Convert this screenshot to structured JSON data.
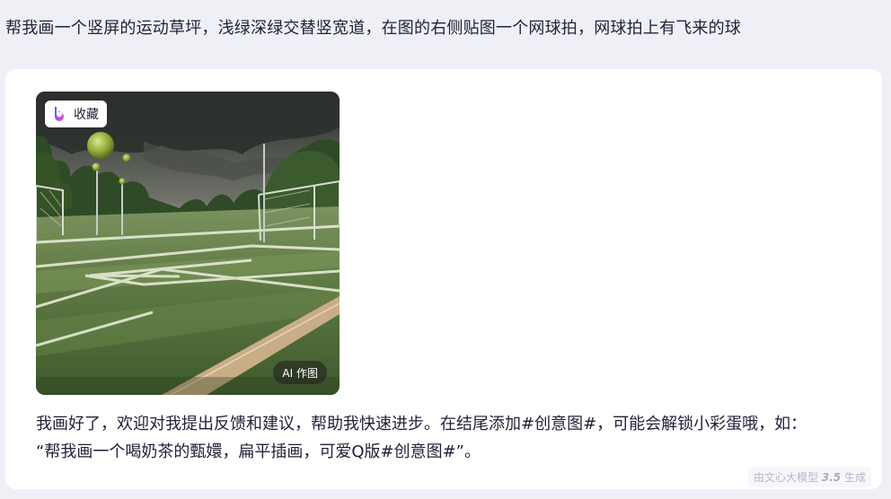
{
  "user_message": {
    "text": "帮我画一个竖屏的运动草坪，浅绿深绿交替竖宽道，在图的右侧贴图一个网球拍，网球拍上有飞来的球"
  },
  "answer": {
    "image": {
      "collect_label": "收藏",
      "logo_icon": "wenxin-logo-icon",
      "ai_badge_label": "AI 作图"
    },
    "text_line1": "我画好了，欢迎对我提出反馈和建议，帮助我快速进步。在结尾添加#创意图#，可能会解锁小彩蛋哦，如：",
    "text_line2": "“帮我画一个喝奶茶的甄嬛，扁平插画，可爱Q版#创意图#”。",
    "footnote_prefix": "由文心大模型",
    "footnote_version": "3.5",
    "footnote_suffix": "生成"
  },
  "colors": {
    "page_bg": "#eef0f6",
    "card_bg": "#ffffff",
    "text": "#222238"
  }
}
